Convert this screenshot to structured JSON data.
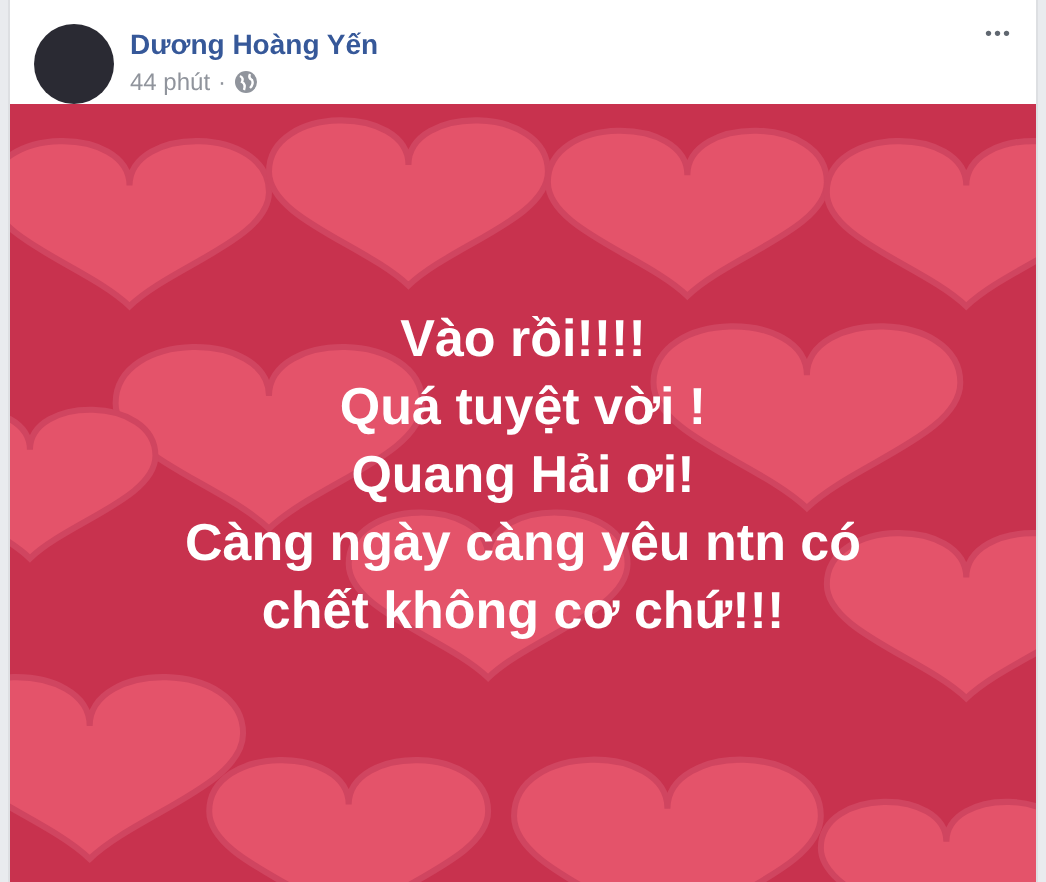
{
  "post": {
    "author": "Dương Hoàng Yến",
    "time": "44 phút",
    "separator": "·",
    "more": "•••",
    "lines": [
      "Vào rồi!!!!",
      "Quá tuyệt vời !",
      "Quang Hải ơi!",
      "Càng ngày càng yêu ntn có",
      "chết không cơ chứ!!!"
    ]
  }
}
